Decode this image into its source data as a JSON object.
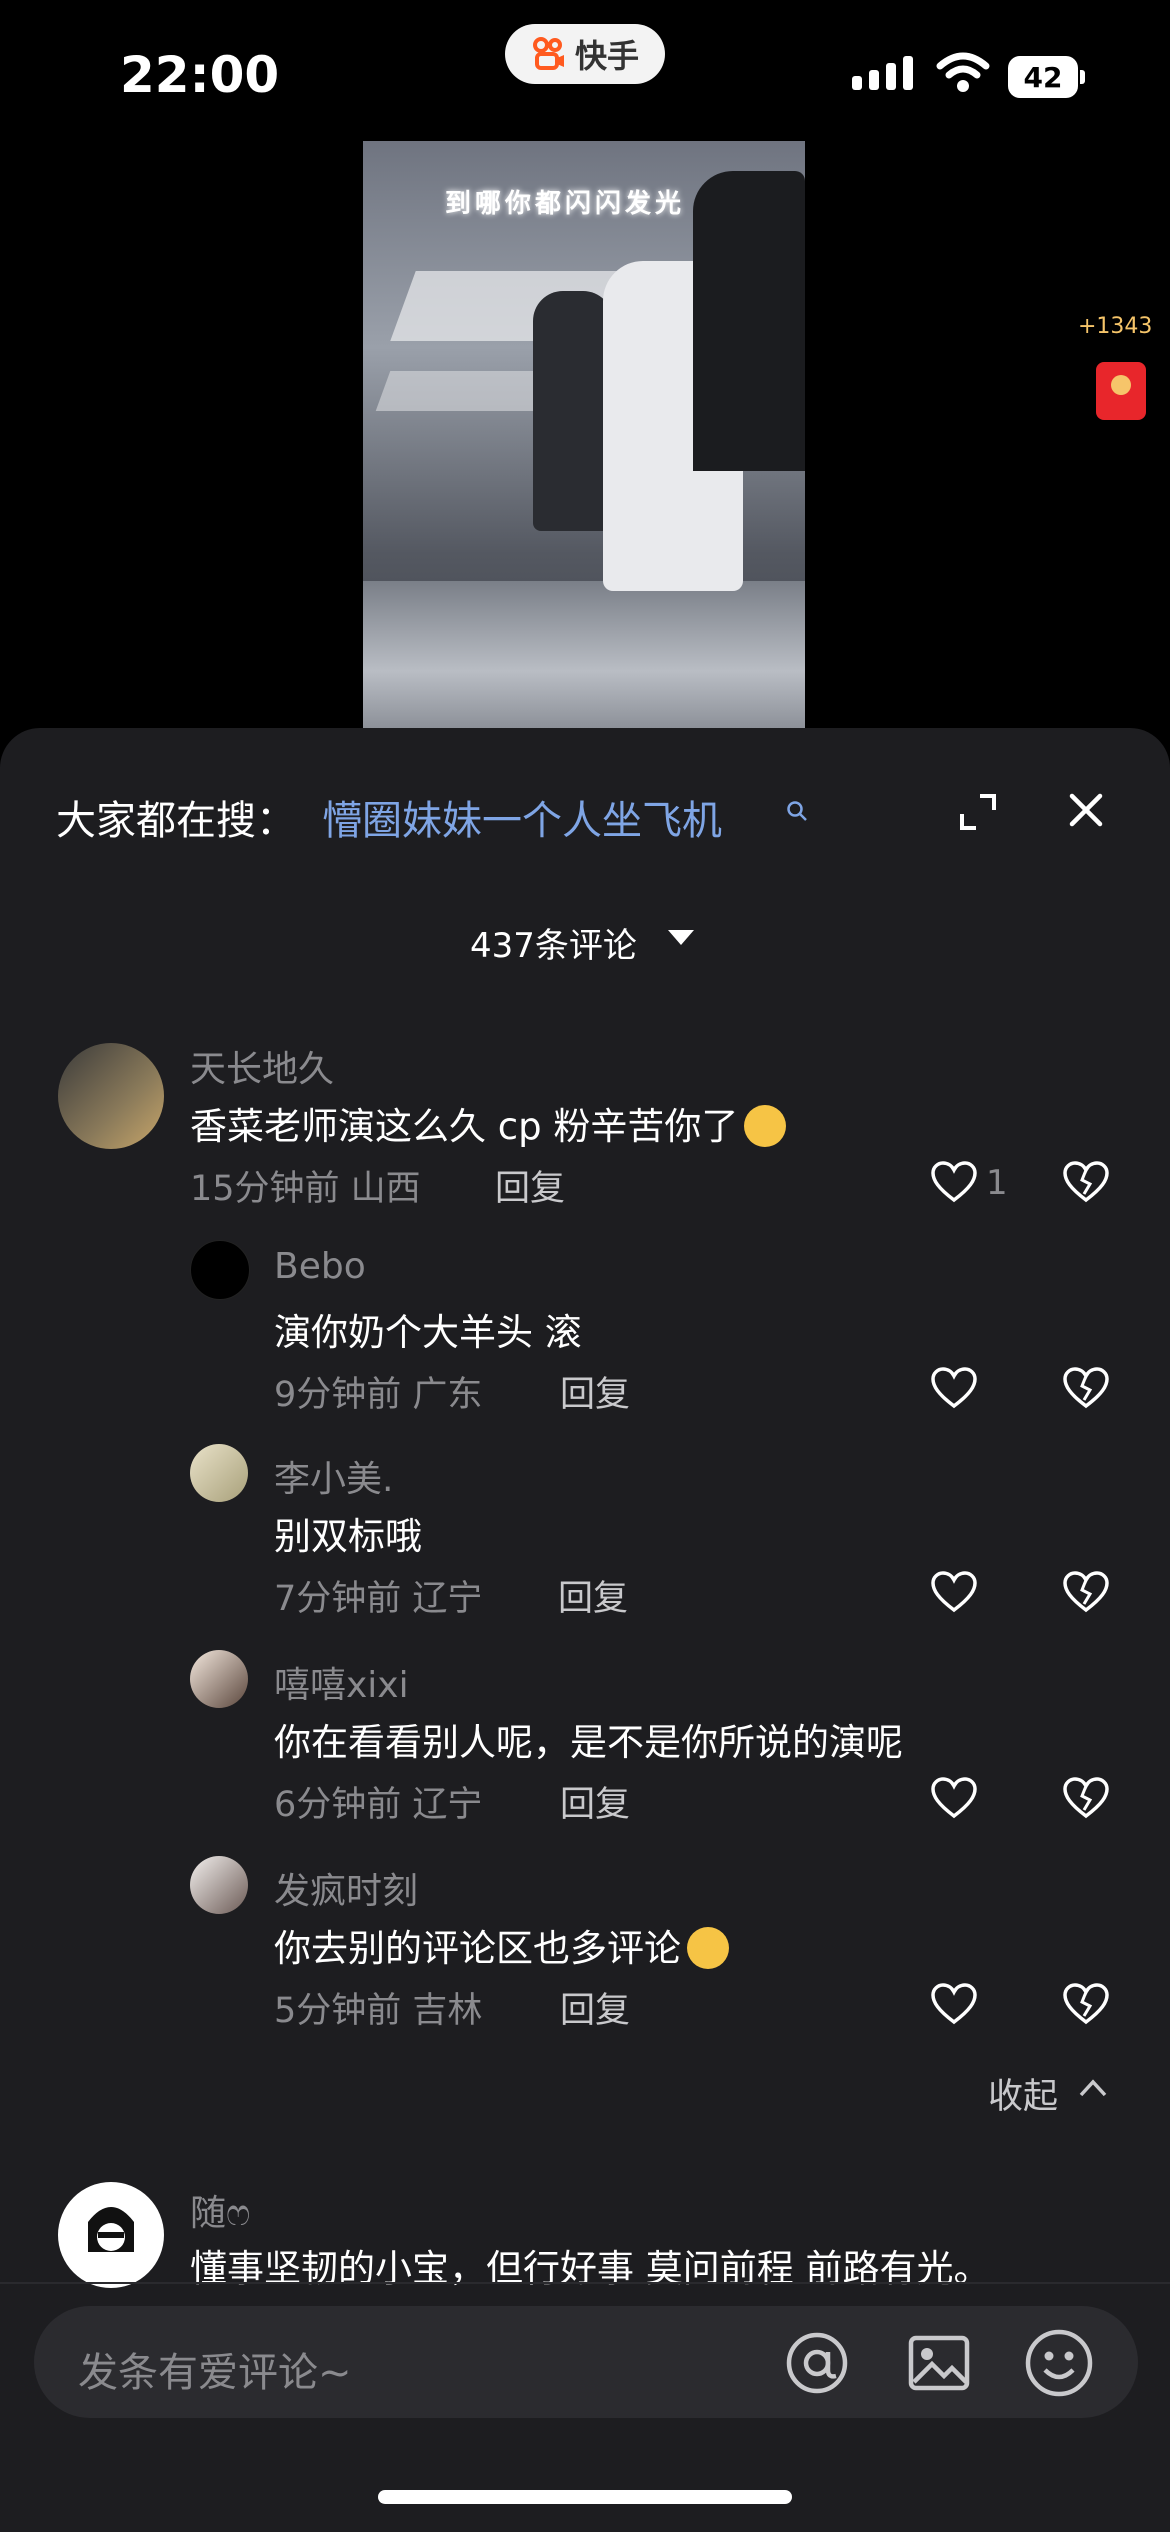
{
  "status": {
    "time": "22:00",
    "app_name": "快手",
    "battery": "42"
  },
  "video": {
    "overlay_text": "到哪你都闪闪发光",
    "reward_count": "+1343"
  },
  "sheet": {
    "search_prefix": "大家都在搜：",
    "search_term": "懵圈妹妹一个人坐飞机",
    "comment_count": "437条评论"
  },
  "comments": [
    {
      "user": "天长地久",
      "text": "香菜老师演这么久 cp 粉辛苦你了",
      "time_loc": "15分钟前 山西",
      "reply": "回复",
      "likes": "1"
    },
    {
      "user": "Bebo",
      "text": "演你奶个大羊头 滚",
      "time_loc": "9分钟前 广东",
      "reply": "回复"
    },
    {
      "user": "李小美.",
      "text": "别双标哦",
      "time_loc": "7分钟前 辽宁",
      "reply": "回复"
    },
    {
      "user": "嘻嘻xixi",
      "text": "你在看看别人呢，是不是你所说的演呢",
      "time_loc": "6分钟前 辽宁",
      "reply": "回复"
    },
    {
      "user": "发疯时刻",
      "text": "你去别的评论区也多评论",
      "time_loc": "5分钟前 吉林",
      "reply": "回复"
    },
    {
      "user": "随ෆ",
      "text": "懂事坚韧的小宝，但行好事 莫问前程 前路有光。"
    }
  ],
  "collapse_label": "收起",
  "input": {
    "placeholder": "发条有爱评论~"
  },
  "colors": {
    "sheet_bg": "#1d1d20",
    "link_blue": "#7fa5e5",
    "muted": "#8a8a8e"
  }
}
